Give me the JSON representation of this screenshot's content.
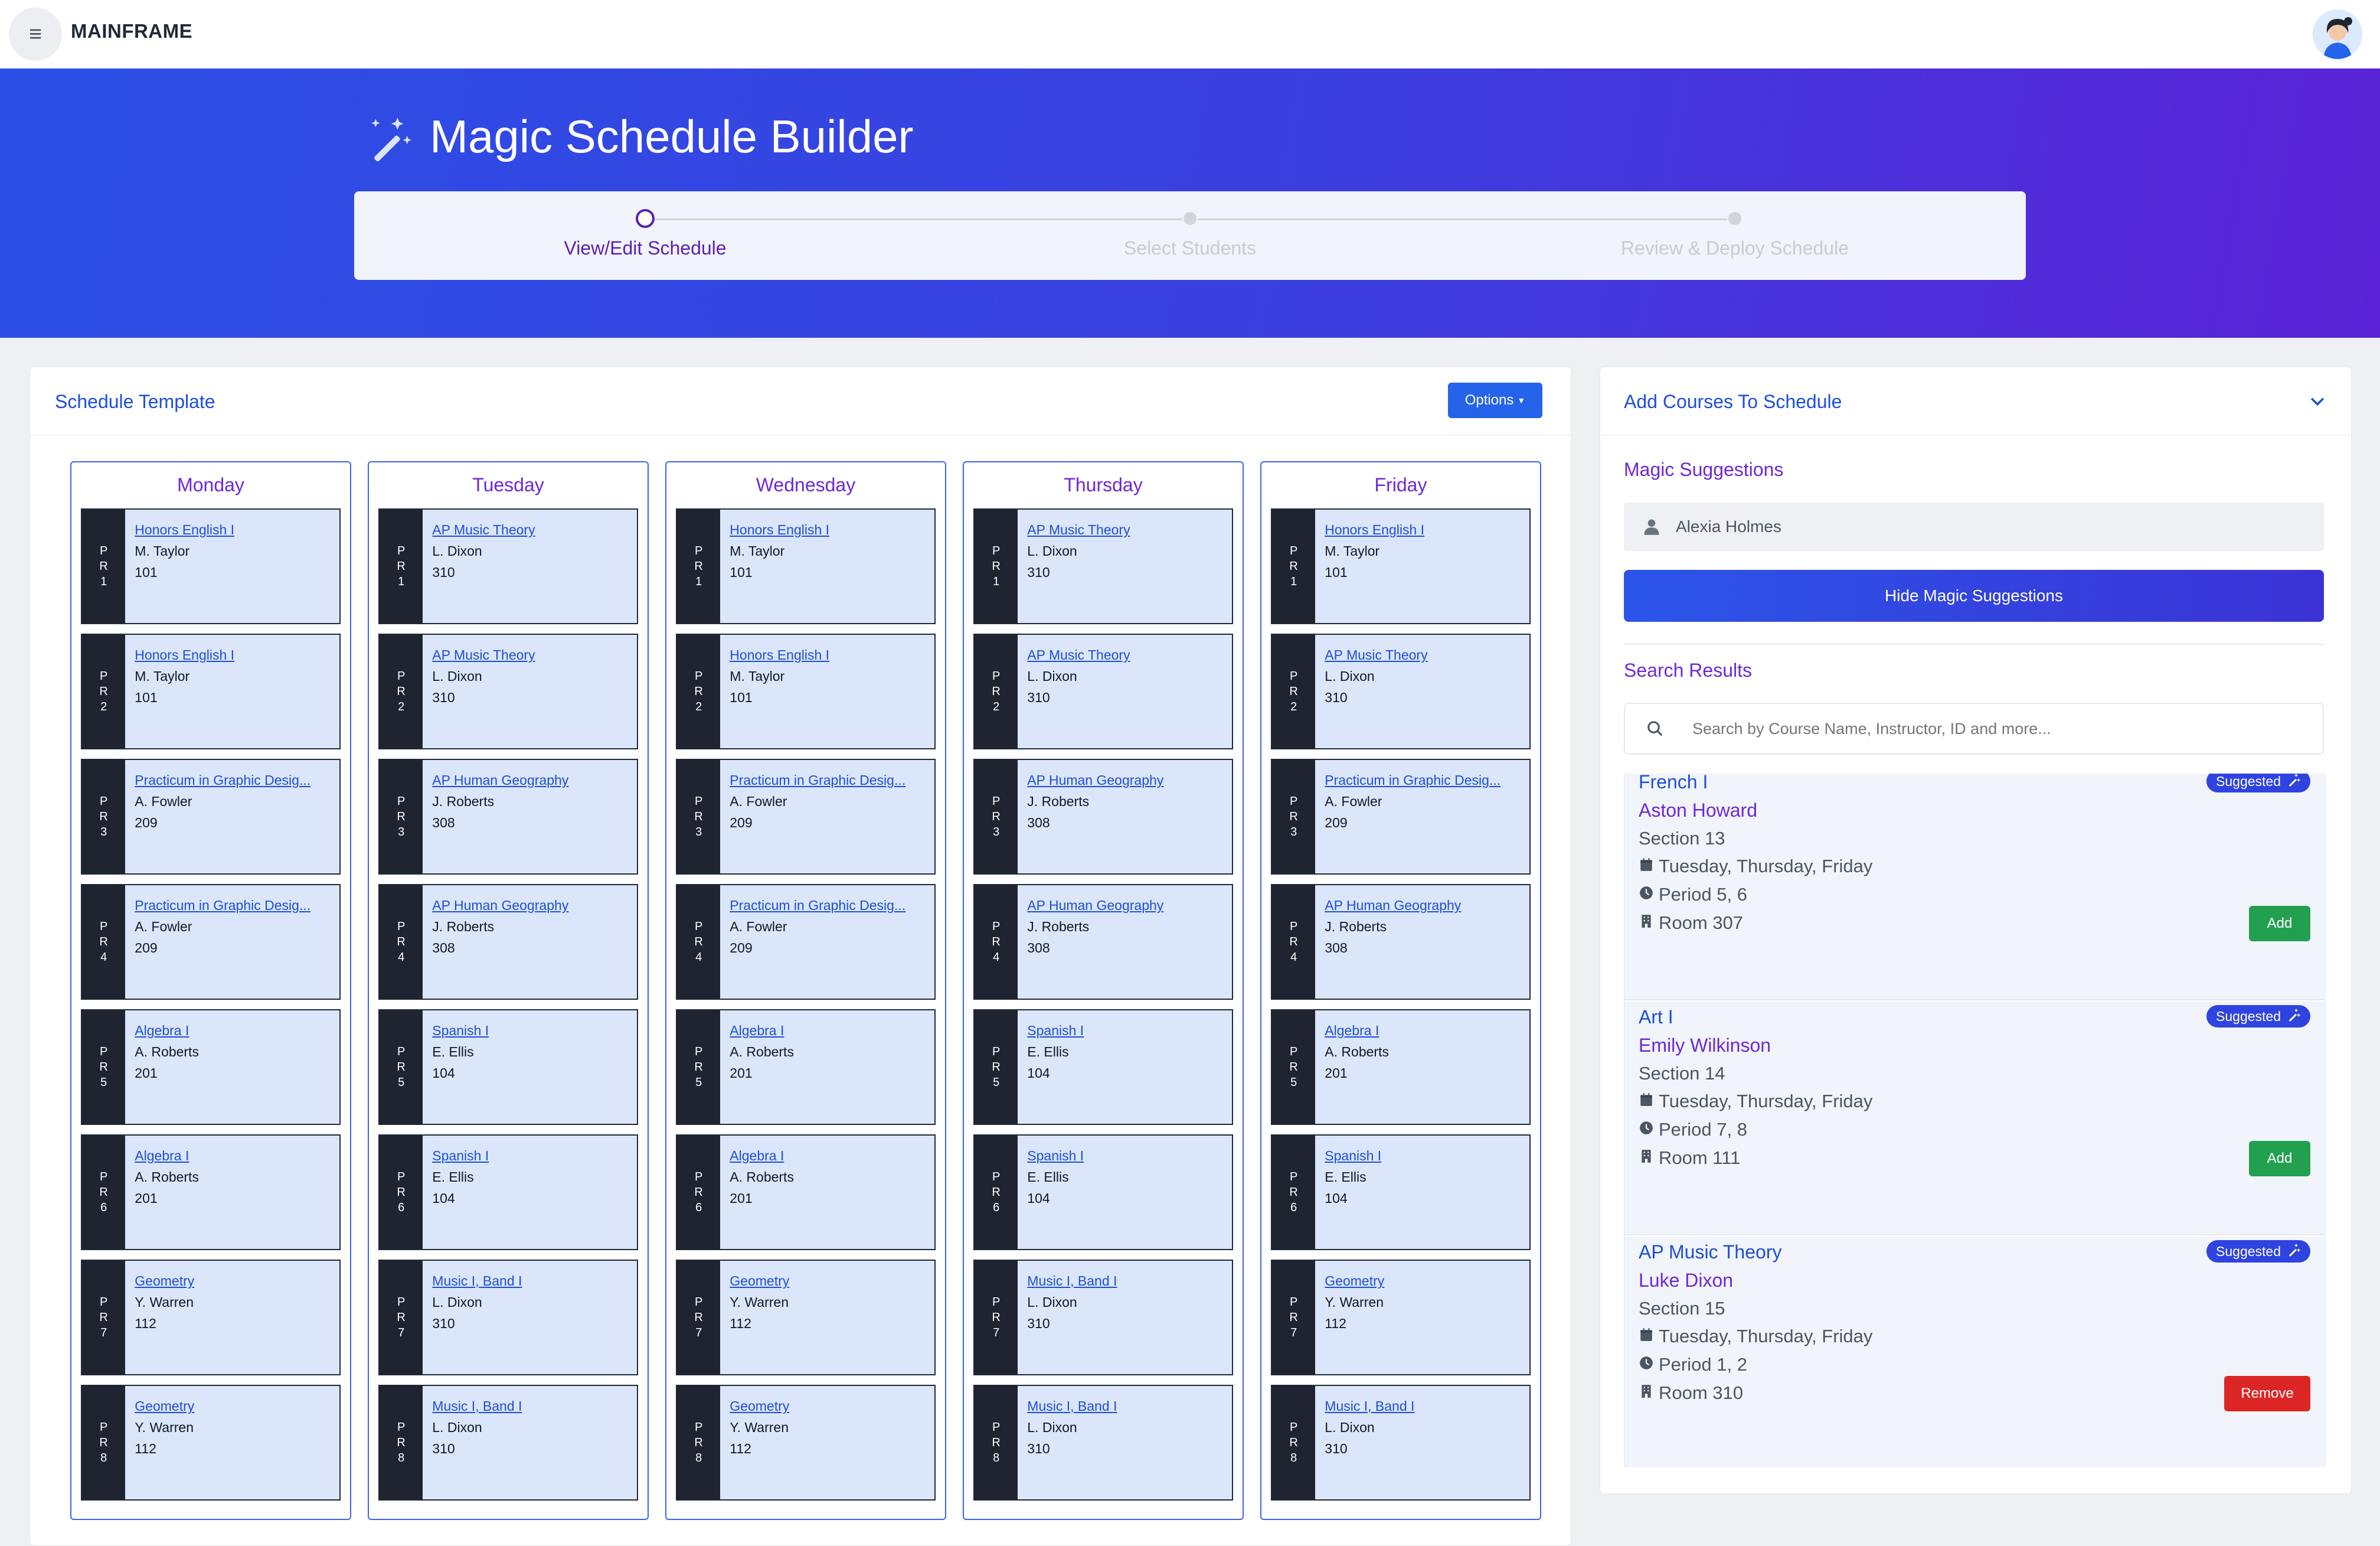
{
  "app": {
    "brand": "MAINFRAME"
  },
  "hero": {
    "title": "Magic Schedule Builder",
    "steps": [
      {
        "label": "View/Edit Schedule",
        "state": "active"
      },
      {
        "label": "Select Students",
        "state": "inactive"
      },
      {
        "label": "Review & Deploy Schedule",
        "state": "inactive"
      }
    ]
  },
  "schedule": {
    "title": "Schedule Template",
    "options_label": "Options",
    "pr_label": "PR",
    "days": [
      {
        "name": "Monday",
        "periods": [
          {
            "num": "1",
            "course": "Honors English I",
            "instructor": "M. Taylor",
            "room": "101"
          },
          {
            "num": "2",
            "course": "Honors English I",
            "instructor": "M. Taylor",
            "room": "101"
          },
          {
            "num": "3",
            "course": "Practicum in Graphic Desig...",
            "instructor": "A. Fowler",
            "room": "209"
          },
          {
            "num": "4",
            "course": "Practicum in Graphic Desig...",
            "instructor": "A. Fowler",
            "room": "209"
          },
          {
            "num": "5",
            "course": "Algebra I",
            "instructor": "A. Roberts",
            "room": "201"
          },
          {
            "num": "6",
            "course": "Algebra I",
            "instructor": "A. Roberts",
            "room": "201"
          },
          {
            "num": "7",
            "course": "Geometry",
            "instructor": "Y. Warren",
            "room": "112"
          },
          {
            "num": "8",
            "course": "Geometry",
            "instructor": "Y. Warren",
            "room": "112"
          }
        ]
      },
      {
        "name": "Tuesday",
        "periods": [
          {
            "num": "1",
            "course": "AP Music Theory",
            "instructor": "L. Dixon",
            "room": "310"
          },
          {
            "num": "2",
            "course": "AP Music Theory",
            "instructor": "L. Dixon",
            "room": "310"
          },
          {
            "num": "3",
            "course": "AP Human Geography",
            "instructor": "J. Roberts",
            "room": "308"
          },
          {
            "num": "4",
            "course": "AP Human Geography",
            "instructor": "J. Roberts",
            "room": "308"
          },
          {
            "num": "5",
            "course": "Spanish I",
            "instructor": "E. Ellis",
            "room": "104"
          },
          {
            "num": "6",
            "course": "Spanish I",
            "instructor": "E. Ellis",
            "room": "104"
          },
          {
            "num": "7",
            "course": "Music I, Band I",
            "instructor": "L. Dixon",
            "room": "310"
          },
          {
            "num": "8",
            "course": "Music I, Band I",
            "instructor": "L. Dixon",
            "room": "310"
          }
        ]
      },
      {
        "name": "Wednesday",
        "periods": [
          {
            "num": "1",
            "course": "Honors English I",
            "instructor": "M. Taylor",
            "room": "101"
          },
          {
            "num": "2",
            "course": "Honors English I",
            "instructor": "M. Taylor",
            "room": "101"
          },
          {
            "num": "3",
            "course": "Practicum in Graphic Desig...",
            "instructor": "A. Fowler",
            "room": "209"
          },
          {
            "num": "4",
            "course": "Practicum in Graphic Desig...",
            "instructor": "A. Fowler",
            "room": "209"
          },
          {
            "num": "5",
            "course": "Algebra I",
            "instructor": "A. Roberts",
            "room": "201"
          },
          {
            "num": "6",
            "course": "Algebra I",
            "instructor": "A. Roberts",
            "room": "201"
          },
          {
            "num": "7",
            "course": "Geometry",
            "instructor": "Y. Warren",
            "room": "112"
          },
          {
            "num": "8",
            "course": "Geometry",
            "instructor": "Y. Warren",
            "room": "112"
          }
        ]
      },
      {
        "name": "Thursday",
        "periods": [
          {
            "num": "1",
            "course": "AP Music Theory",
            "instructor": "L. Dixon",
            "room": "310"
          },
          {
            "num": "2",
            "course": "AP Music Theory",
            "instructor": "L. Dixon",
            "room": "310"
          },
          {
            "num": "3",
            "course": "AP Human Geography",
            "instructor": "J. Roberts",
            "room": "308"
          },
          {
            "num": "4",
            "course": "AP Human Geography",
            "instructor": "J. Roberts",
            "room": "308"
          },
          {
            "num": "5",
            "course": "Spanish I",
            "instructor": "E. Ellis",
            "room": "104"
          },
          {
            "num": "6",
            "course": "Spanish I",
            "instructor": "E. Ellis",
            "room": "104"
          },
          {
            "num": "7",
            "course": "Music I, Band I",
            "instructor": "L. Dixon",
            "room": "310"
          },
          {
            "num": "8",
            "course": "Music I, Band I",
            "instructor": "L. Dixon",
            "room": "310"
          }
        ]
      },
      {
        "name": "Friday",
        "periods": [
          {
            "num": "1",
            "course": "Honors English I",
            "instructor": "M. Taylor",
            "room": "101"
          },
          {
            "num": "2",
            "course": "AP Music Theory",
            "instructor": "L. Dixon",
            "room": "310"
          },
          {
            "num": "3",
            "course": "Practicum in Graphic Desig...",
            "instructor": "A. Fowler",
            "room": "209"
          },
          {
            "num": "4",
            "course": "AP Human Geography",
            "instructor": "J. Roberts",
            "room": "308"
          },
          {
            "num": "5",
            "course": "Algebra I",
            "instructor": "A. Roberts",
            "room": "201"
          },
          {
            "num": "6",
            "course": "Spanish I",
            "instructor": "E. Ellis",
            "room": "104"
          },
          {
            "num": "7",
            "course": "Geometry",
            "instructor": "Y. Warren",
            "room": "112"
          },
          {
            "num": "8",
            "course": "Music I, Band I",
            "instructor": "L. Dixon",
            "room": "310"
          }
        ]
      }
    ]
  },
  "add_courses": {
    "title": "Add Courses To Schedule",
    "magic_title": "Magic Suggestions",
    "student": "Alexia Holmes",
    "hide_label": "Hide Magic Suggestions",
    "search_title": "Search Results",
    "search_placeholder": "Search by Course Name, Instructor, ID and more...",
    "results": [
      {
        "course": "French I",
        "instructor": "Aston Howard",
        "section": "Section 13",
        "days": "Tuesday, Thursday, Friday",
        "period": "Period 5, 6",
        "room": "Room 307",
        "badge": "Suggested",
        "action": "Add",
        "action_type": "add"
      },
      {
        "course": "Art I",
        "instructor": "Emily Wilkinson",
        "section": "Section 14",
        "days": "Tuesday, Thursday, Friday",
        "period": "Period 7, 8",
        "room": "Room 111",
        "badge": "Suggested",
        "action": "Add",
        "action_type": "add"
      },
      {
        "course": "AP Music Theory",
        "instructor": "Luke Dixon",
        "section": "Section 15",
        "days": "Tuesday, Thursday, Friday",
        "period": "Period 1, 2",
        "room": "Room 310",
        "badge": "Suggested",
        "action": "Remove",
        "action_type": "remove"
      }
    ]
  }
}
